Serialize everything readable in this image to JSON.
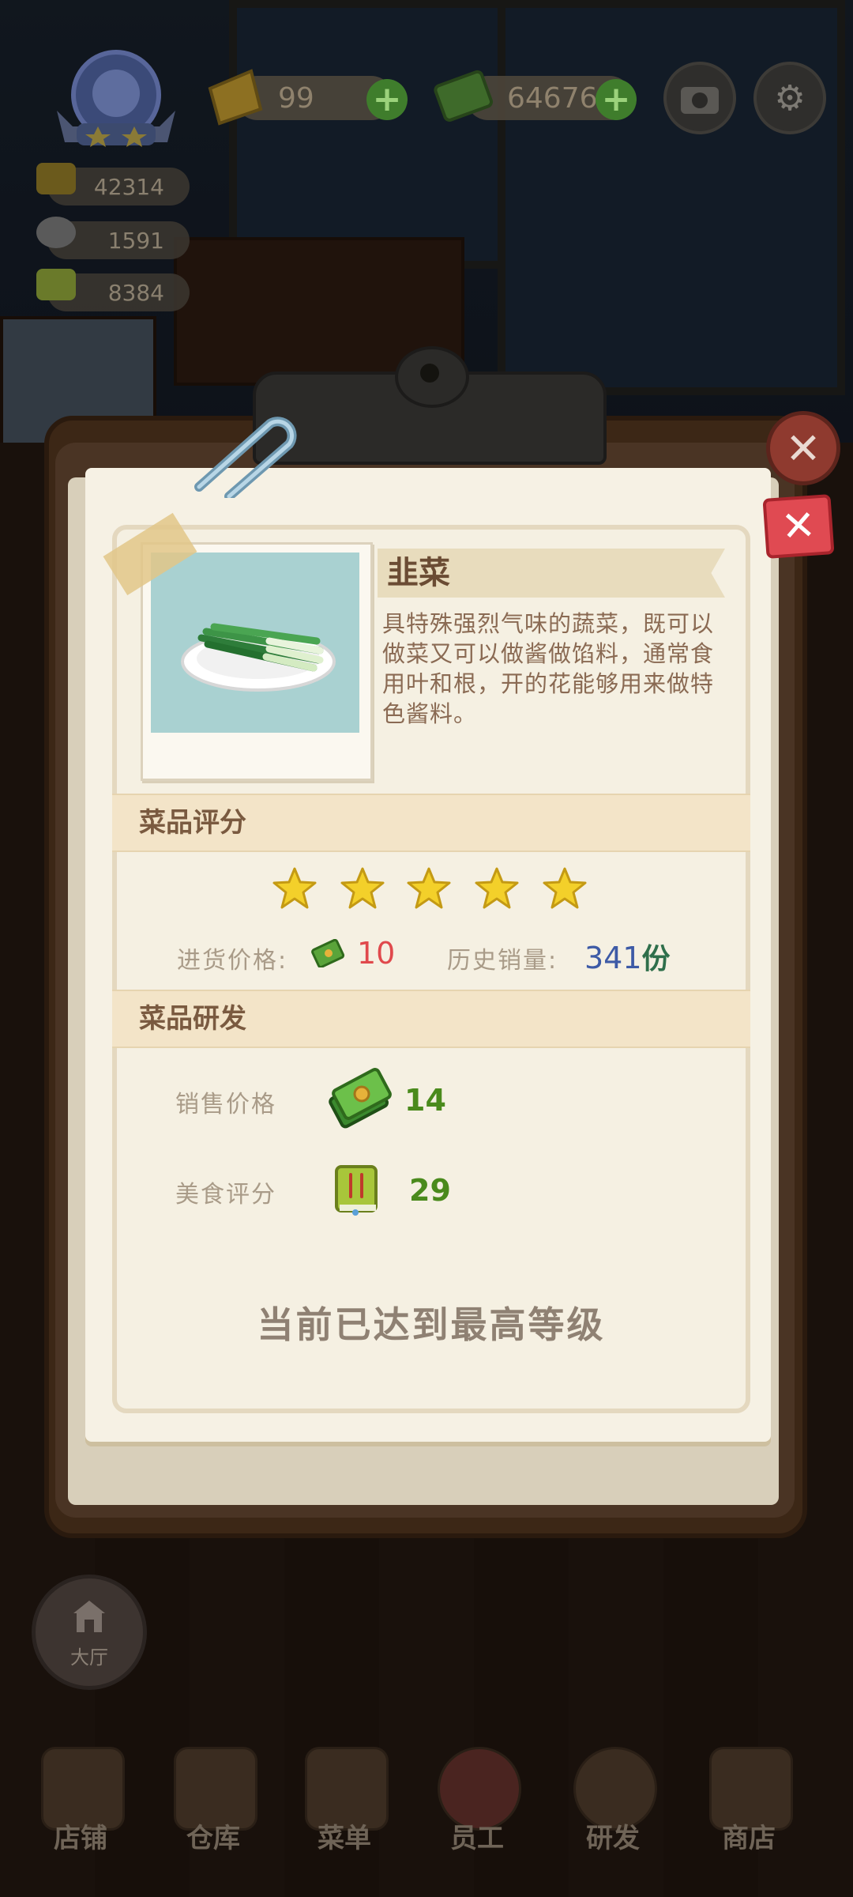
{
  "hud": {
    "tickets": "99",
    "cash": "64676",
    "stats": [
      "42314",
      "1591",
      "8384"
    ]
  },
  "dish": {
    "name": "韭菜",
    "description": "具特殊强烈气味的蔬菜，既可以做菜又可以做酱做馅料，通常食用叶和根，开的花能够用来做特色酱料。"
  },
  "rating_section": {
    "title": "菜品评分",
    "stars": 5,
    "purchase_price_label": "进货价格:",
    "purchase_price": "10",
    "history_sales_label": "历史销量:",
    "history_sales": "341",
    "history_sales_unit": "份"
  },
  "rd_section": {
    "title": "菜品研发",
    "sale_price_label": "销售价格",
    "sale_price": "14",
    "food_rating_label": "美食评分",
    "food_rating": "29",
    "max_level_text": "当前已达到最高等级"
  },
  "lobby": {
    "label": "大厅"
  },
  "nav": [
    "店铺",
    "仓库",
    "菜单",
    "员工",
    "研发",
    "商店"
  ],
  "colors": {
    "star": "#f3d02a",
    "close": "#e04a52",
    "price_red": "#e0494c",
    "sales_blue": "#3d5aa6",
    "value_green": "#4a8a1c"
  }
}
